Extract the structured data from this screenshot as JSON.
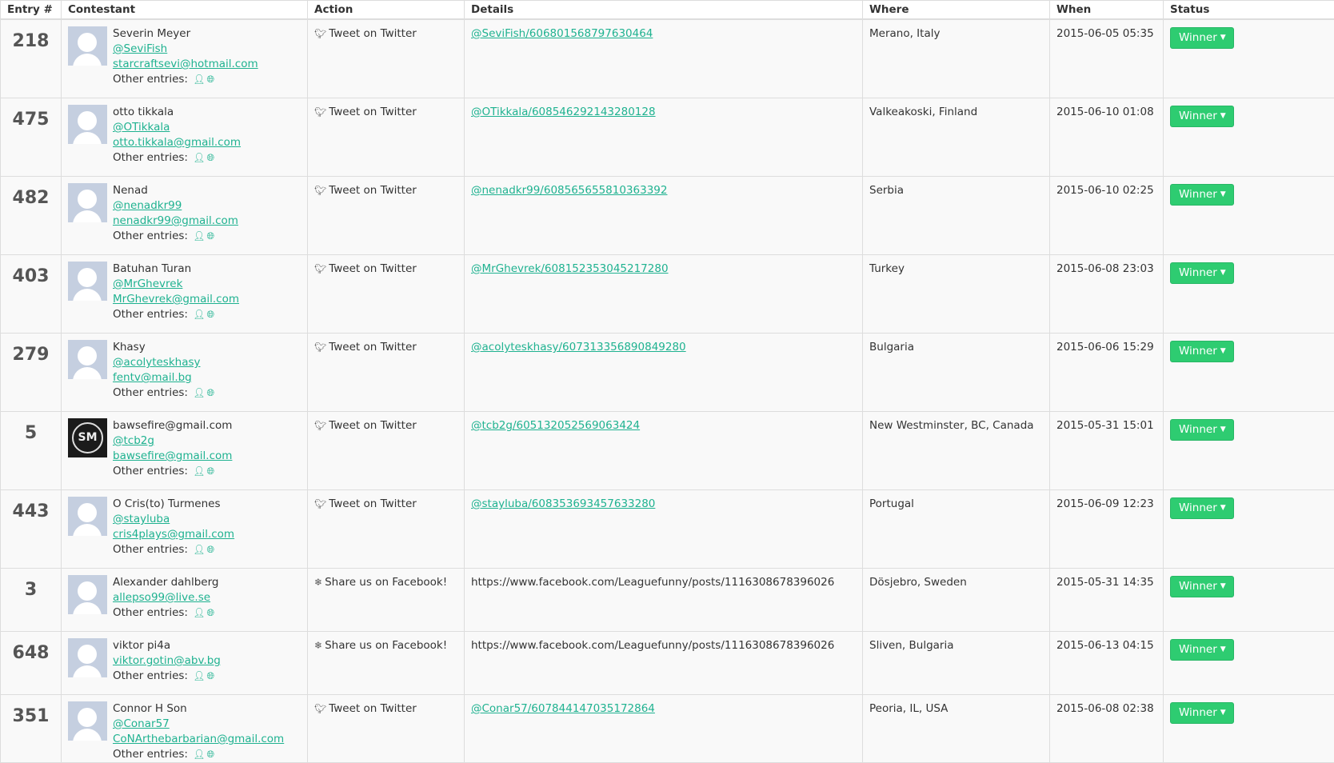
{
  "headers": {
    "entry": "Entry #",
    "contestant": "Contestant",
    "action": "Action",
    "details": "Details",
    "where": "Where",
    "when": "When",
    "status": "Status"
  },
  "icons": {
    "twitter": "twitter-icon",
    "facebook_share": "magic-wand-icon",
    "user": "user-icon",
    "globe": "globe-icon",
    "caret": "caret-down-icon"
  },
  "colors": {
    "link": "#1fb290",
    "winner_button": "#2ecc71",
    "row_background": "#f9f9f9",
    "border": "#dddddd"
  },
  "other_entries_label": "Other entries:",
  "rows": [
    {
      "entry": "218",
      "name": "Severin Meyer",
      "handle": "@SeviFish",
      "email": "starcraftsevi@hotmail.com",
      "action": "Tweet on Twitter",
      "details": "@SeviFish/606801568797630464",
      "where": "Merano, Italy",
      "when": "2015-06-05 05:35",
      "status": "Winner"
    },
    {
      "entry": "475",
      "name": "otto tikkala",
      "handle": "@OTikkala",
      "email": "otto.tikkala@gmail.com",
      "action": "Tweet on Twitter",
      "details": "@OTikkala/608546292143280128",
      "where": "Valkeakoski, Finland",
      "when": "2015-06-10 01:08",
      "status": "Winner"
    },
    {
      "entry": "482",
      "name": "Nenad",
      "handle": "@nenadkr99",
      "email": "nenadkr99@gmail.com",
      "action": "Tweet on Twitter",
      "details": "@nenadkr99/608565655810363392",
      "where": "Serbia",
      "when": "2015-06-10 02:25",
      "status": "Winner"
    },
    {
      "entry": "403",
      "name": "Batuhan Turan",
      "handle": "@MrGhevrek",
      "email": "MrGhevrek@gmail.com",
      "action": "Tweet on Twitter",
      "details": "@MrGhevrek/608152353045217280",
      "where": "Turkey",
      "when": "2015-06-08 23:03",
      "status": "Winner"
    },
    {
      "entry": "279",
      "name": "Khasy",
      "handle": "@acolyteskhasy",
      "email": "fentv@mail.bg",
      "action": "Tweet on Twitter",
      "details": "@acolyteskhasy/607313356890849280",
      "where": "Bulgaria",
      "when": "2015-06-06 15:29",
      "status": "Winner"
    },
    {
      "entry": "5",
      "name": "bawsefire@gmail.com",
      "handle": "@tcb2g",
      "email": "bawsefire@gmail.com",
      "action": "Tweet on Twitter",
      "details": "@tcb2g/605132052569063424",
      "where": "New Westminster, BC, Canada",
      "when": "2015-05-31 15:01",
      "status": "Winner",
      "avatar_logo": "SM"
    },
    {
      "entry": "443",
      "name": "O Cris(to) Turmenes",
      "handle": "@stayluba",
      "email": "cris4plays@gmail.com",
      "action": "Tweet on Twitter",
      "details": "@stayluba/608353693457633280",
      "where": "Portugal",
      "when": "2015-06-09 12:23",
      "status": "Winner"
    },
    {
      "entry": "3",
      "name": "Alexander dahlberg",
      "email": "allepso99@live.se",
      "action": "Share us on Facebook!",
      "details": "https://www.facebook.com/Leaguefunny/posts/1116308678396026",
      "where": "Dösjebro, Sweden",
      "when": "2015-05-31 14:35",
      "status": "Winner"
    },
    {
      "entry": "648",
      "name": "viktor pi4a",
      "email": "viktor.gotin@abv.bg",
      "action": "Share us on Facebook!",
      "details": "https://www.facebook.com/Leaguefunny/posts/1116308678396026",
      "where": "Sliven, Bulgaria",
      "when": "2015-06-13 04:15",
      "status": "Winner"
    },
    {
      "entry": "351",
      "name": "Connor H Son",
      "handle": "@Conar57",
      "email": "CoNArthebarbarian@gmail.com",
      "action": "Tweet on Twitter",
      "details": "@Conar57/607844147035172864",
      "where": "Peoria, IL, USA",
      "when": "2015-06-08 02:38",
      "status": "Winner"
    }
  ]
}
